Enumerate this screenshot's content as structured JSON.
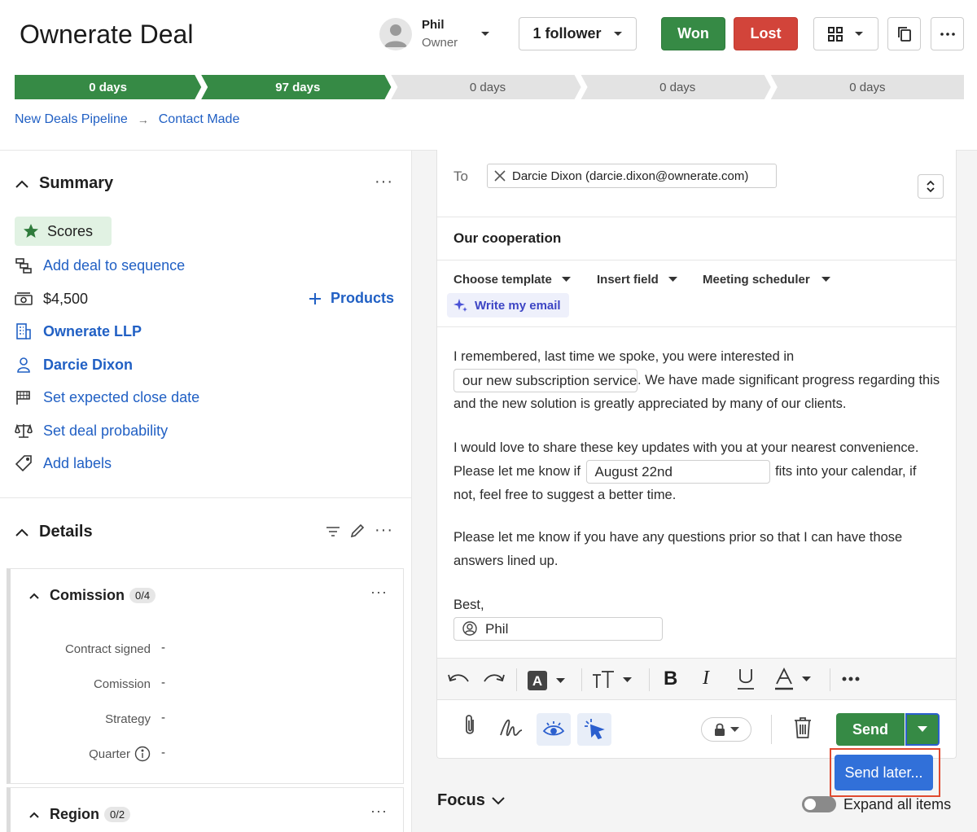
{
  "header": {
    "title": "Ownerate Deal",
    "owner_name": "Phil",
    "owner_role": "Owner",
    "follower_label": "1 follower",
    "won_label": "Won",
    "lost_label": "Lost"
  },
  "pipeline": {
    "stages": [
      {
        "label": "0 days",
        "done": true
      },
      {
        "label": "97 days",
        "done": true
      },
      {
        "label": "0 days",
        "done": false
      },
      {
        "label": "0 days",
        "done": false
      },
      {
        "label": "0 days",
        "done": false
      }
    ],
    "breadcrumb": [
      "New Deals Pipeline",
      "Contact Made"
    ]
  },
  "summary": {
    "title": "Summary",
    "scores_label": "Scores",
    "add_sequence": "Add deal to sequence",
    "value": "$4,500",
    "products_label": "Products",
    "organization": "Ownerate LLP",
    "person": "Darcie Dixon",
    "close_date": "Set expected close date",
    "probability": "Set deal probability",
    "labels": "Add labels"
  },
  "details": {
    "title": "Details",
    "commission": {
      "title": "Comission",
      "badge": "0/4",
      "fields": [
        {
          "label": "Contract signed",
          "value": "-"
        },
        {
          "label": "Comission",
          "value": "-"
        },
        {
          "label": "Strategy",
          "value": "-"
        },
        {
          "label": "Quarter",
          "value": "-"
        }
      ]
    },
    "region": {
      "title": "Region",
      "badge": "0/2"
    }
  },
  "composer": {
    "to_label": "To",
    "recipient": "Darcie Dixon (darcie.dixon@ownerate.com)",
    "subject": "Our cooperation",
    "choose_template": "Choose template",
    "insert_field": "Insert field",
    "meeting_scheduler": "Meeting scheduler",
    "write_my_email": "Write my email",
    "body": {
      "p1_a": "I remembered, last time we spoke, you were interested in",
      "p1_field": "our new subscription service",
      "p1_b": ". We have made significant progress regarding this and the new solution is greatly appreciated by many of our clients.",
      "p2_a": "I would love to share these key updates with you at your nearest convenience. Please let me know if",
      "p2_field": "August 22nd",
      "p2_b": "fits into your calendar, if not, feel free to suggest a better time.",
      "p3": "Please let me know if you have any questions prior so that I can have those answers lined up.",
      "closing": "Best,",
      "signature": "Phil"
    },
    "send_label": "Send",
    "send_later_label": "Send later..."
  },
  "focus": {
    "title": "Focus",
    "expand_all": "Expand all items"
  },
  "colors": {
    "green": "#368a45",
    "red": "#d2443a",
    "link": "#2160c4",
    "blue_button": "#3170d9",
    "highlight": "#e04a2f"
  }
}
